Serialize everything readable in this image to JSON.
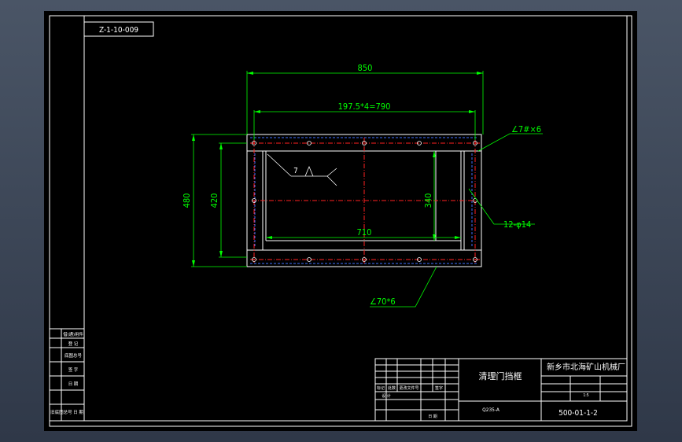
{
  "drawing_code": "Z-1-10-009",
  "dimensions": {
    "overall_width": "850",
    "hole_pitch": "197.5*4=790",
    "overall_height": "480",
    "inner_height": "420",
    "inner_width": "710",
    "window_height": "340"
  },
  "callouts": {
    "angle_small": "∠7#×6",
    "holes": "12-φ14",
    "angle_large": "∠70*6",
    "weld": "7"
  },
  "left_strip": [
    "借(通)用件",
    "登 记",
    "底图总号",
    "签 字",
    "日 期",
    "旧底图总号 日 期"
  ],
  "title_block": {
    "part_name": "清理门挡框",
    "material": "Q235-A",
    "company": "新乡市北海矿山机械厂",
    "drawing_number": "500-01-1-2",
    "ratio": "1:5",
    "small_cells": [
      "标记",
      "处数",
      "更改文件号",
      "签字",
      "设 计",
      "日 期"
    ]
  },
  "colors": {
    "border": "#ffffff",
    "dimension": "#00ff00",
    "part_outline": "#ffffff",
    "centerline": "#ff2020",
    "dashed_blue": "#4070ff",
    "background": "#000000"
  }
}
